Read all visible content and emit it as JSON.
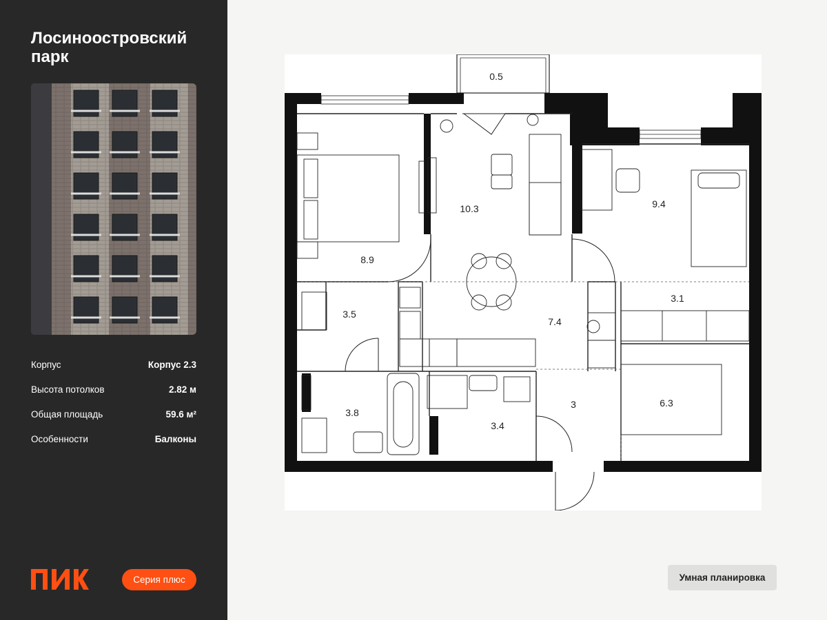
{
  "project": {
    "title": "Лосиноостровский парк"
  },
  "specs": [
    {
      "label": "Корпус",
      "value": "Корпус 2.3"
    },
    {
      "label": "Высота потолков",
      "value": "2.82 м"
    },
    {
      "label": "Общая площадь",
      "value": "59.6 м²"
    },
    {
      "label": "Особенности",
      "value": "Балконы"
    }
  ],
  "brand": {
    "logo_text": "ПИК",
    "series_label": "Серия плюс",
    "accent": "#ff4f12"
  },
  "badge": {
    "label": "Умная планировка"
  },
  "floorplan": {
    "rooms": [
      {
        "id": "balcony",
        "area": "0.5"
      },
      {
        "id": "bedroom",
        "area": "8.9"
      },
      {
        "id": "living",
        "area": "10.3"
      },
      {
        "id": "bedroom2",
        "area": "9.4"
      },
      {
        "id": "wardrobe",
        "area": "3.5"
      },
      {
        "id": "kitchen",
        "area": "7.4"
      },
      {
        "id": "corridor",
        "area": "3.1"
      },
      {
        "id": "bathroom",
        "area": "3.8"
      },
      {
        "id": "wc",
        "area": "3.4"
      },
      {
        "id": "hall",
        "area": "3"
      },
      {
        "id": "storage",
        "area": "6.3"
      }
    ]
  }
}
